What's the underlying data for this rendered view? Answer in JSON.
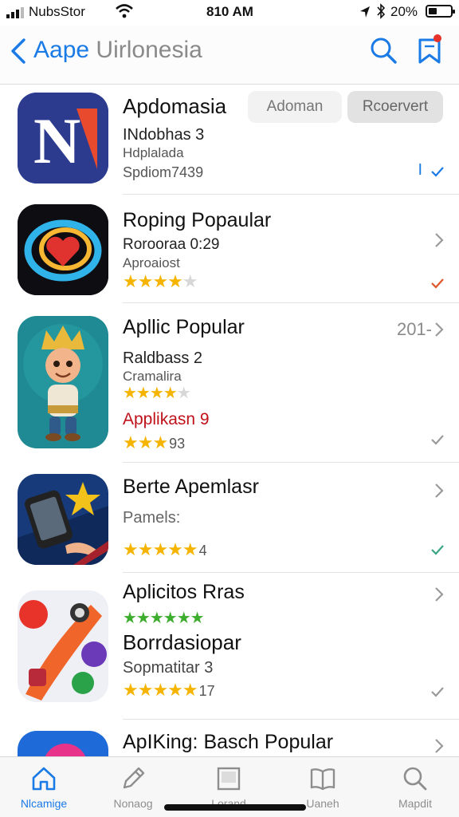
{
  "status_bar": {
    "carrier": "NubsStor",
    "time": "810 AM",
    "battery_percent": "20%",
    "battery_level": 0.2,
    "icons": [
      "signal-icon",
      "wifi-icon",
      "location-arrow-icon",
      "bluetooth-icon",
      "battery-icon"
    ]
  },
  "nav": {
    "back_icon": "chevron-left-icon",
    "title_primary": "Aape",
    "title_secondary": "Uirlonesia",
    "search_icon": "search-icon",
    "bookmark_icon": "bookmark-icon"
  },
  "colors": {
    "accent": "#1a7ae6",
    "star": "#f5b400",
    "red_text": "#c0111b",
    "check_blue": "#1a7ae6",
    "check_orange": "#e0562a",
    "check_green": "#3aa585"
  },
  "apps": [
    {
      "title": "Apdomasia",
      "line1": "INdobhas 3",
      "line2": "Hdplalada",
      "line3": "Spdiom7439",
      "button_left": "Adoman",
      "button_right": "Rcoervert",
      "side_mark": "I",
      "icon": "letter-n-icon"
    },
    {
      "title": "Roping Popaular",
      "line1": "Rorooraa 0:29",
      "line2": "Aproaiost",
      "rating": 4.5,
      "stars": "★★★★",
      "stars_dim": "★",
      "icon": "heart-swirl-icon"
    },
    {
      "title": "Apllic Popular",
      "side_num": "201-",
      "line1": "Raldbass 2",
      "line2": "Cramalira",
      "rating_a": 4.5,
      "stars_a": "★★★★",
      "stars_a_dim": "★",
      "red_label": "Applikasn 9",
      "rating_b": 3,
      "stars_b": "★★★",
      "stars_b_num": "93",
      "icon": "cartoon-king-icon"
    },
    {
      "title": "Berte Apemlasr",
      "line1": "Pamels:",
      "rating": 5,
      "stars": "★★★★★",
      "stars_num": "4",
      "icon": "phone-star-icon"
    },
    {
      "title": "Aplicitos Rras",
      "green_stars": "★★★★★★",
      "subtitle2": "Borrdasiopar",
      "line1": "Sopmatitar 3",
      "rating": 5,
      "stars": "★★★★★",
      "stars_num": "17",
      "icon": "creative-apps-icon"
    },
    {
      "title": "ApIKing: Basch Popular",
      "icon": "pink-circle-icon"
    }
  ],
  "tabs": [
    {
      "label": "Nlcamige",
      "icon": "home-icon",
      "active": true
    },
    {
      "label": "Nonaog",
      "icon": "pencil-icon",
      "active": false
    },
    {
      "label": "Lorand",
      "icon": "square-icon",
      "active": false
    },
    {
      "label": "Uaneh",
      "icon": "book-icon",
      "active": false
    },
    {
      "label": "Mapdit",
      "icon": "search-icon",
      "active": false
    }
  ]
}
